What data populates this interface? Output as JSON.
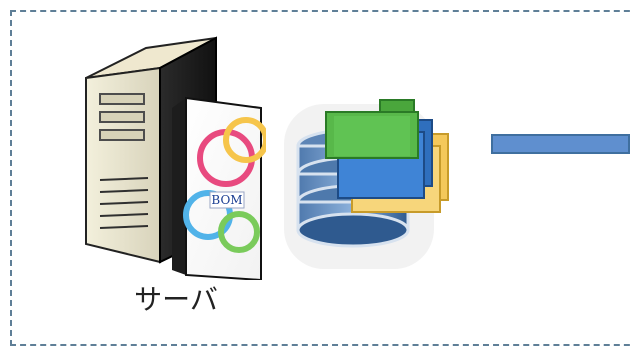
{
  "diagram": {
    "server_label": "サーバ",
    "box_text_top": "BOM",
    "colors": {
      "frame": "#5f7f97",
      "connector": "#5f8fcf",
      "db": "#5b83b5",
      "folder_green": "#52b043",
      "folder_blue": "#2f6fbd",
      "folder_yellow": "#f2c24c"
    },
    "icons": [
      "server-icon",
      "software-box-icon",
      "database-icon",
      "folders-icon"
    ]
  }
}
